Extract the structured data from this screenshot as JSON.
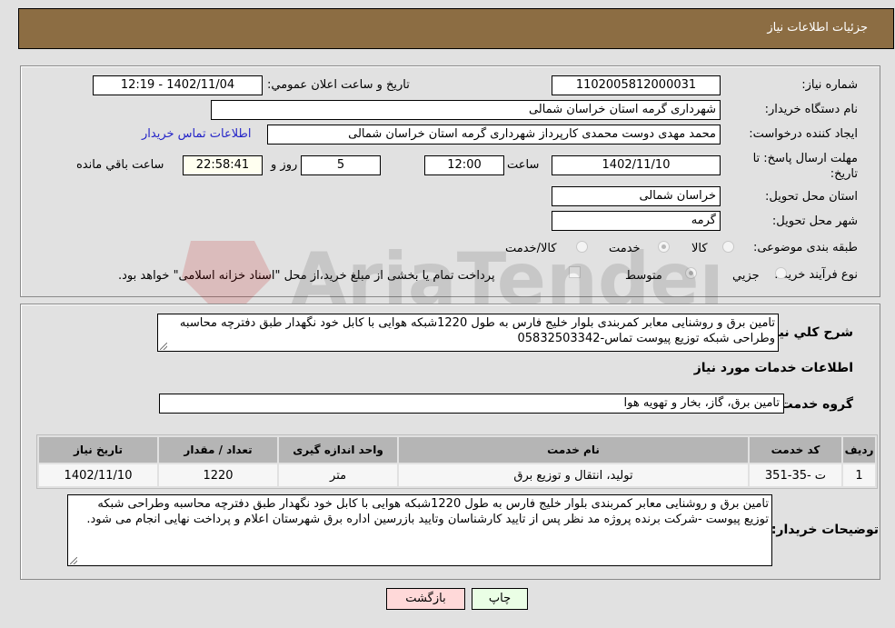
{
  "header": {
    "title": "جزئیات اطلاعات نیاز"
  },
  "details": {
    "need_number": {
      "label": "شماره نیاز:",
      "value": "1102005812000031"
    },
    "announce_datetime": {
      "label": "تاریخ و ساعت اعلان عمومي:",
      "value": "1402/11/04 - 12:19"
    },
    "buyer_org": {
      "label": "نام دستگاه خريدار:",
      "value": "شهرداری گرمه استان خراسان شمالی"
    },
    "requester": {
      "label": "ايجاد کننده درخواست:",
      "value": "محمد مهدی دوست محمدی کارپرداز شهرداری گرمه استان خراسان شمالی",
      "contact_link": "اطلاعات تماس خریدار"
    },
    "deadline": {
      "label": "مهلت ارسال پاسخ: تا تاریخ:",
      "date": "1402/11/10",
      "time_label": "ساعت",
      "time": "12:00",
      "days": "5",
      "days_label": "روز و",
      "remaining": "22:58:41",
      "remaining_label": "ساعت باقي مانده"
    },
    "delivery_province": {
      "label": "استان محل تحویل:",
      "value": "خراسان شمالی"
    },
    "delivery_city": {
      "label": "شهر محل تحویل:",
      "value": "گرمه"
    },
    "category": {
      "label": "طبقه بندی موضوعی:",
      "options": [
        "کالا",
        "خدمت",
        "کالا/خدمت"
      ],
      "selected": "خدمت"
    },
    "purchase_type": {
      "label": "نوع فرآیند خرید :",
      "options": [
        "جزيي",
        "متوسط"
      ],
      "selected": "متوسط",
      "treasury_note": "پرداخت تمام یا بخشی از مبلغ خرید،از محل \"اسناد خزانه اسلامی\" خواهد بود.",
      "treasury_checked": false
    }
  },
  "general": {
    "label": "شرح کلي نياز:",
    "text": "تامین برق و روشنایی معابر کمربندی بلوار خلیج فارس  به طول 1220شبکه هوایی با کابل خود نگهدار طبق دفترچه محاسبه وطراحی شبکه توزیع پیوست تماس-05832503342"
  },
  "services": {
    "section_title": "اطلاعات خدمات مورد نياز",
    "group_label": "گروه خدمت:",
    "group_value": "تامین برق، گاز، بخار و تهویه هوا",
    "table": {
      "headers": [
        "رديف",
        "کد خدمت",
        "نام خدمت",
        "واحد اندازه گيری",
        "تعداد / مقدار",
        "تاريخ نياز"
      ],
      "rows": [
        [
          "1",
          "ت -35-351",
          "تولید، انتقال و توزیع برق",
          "متر",
          "1220",
          "1402/11/10"
        ]
      ]
    }
  },
  "buyer_notes": {
    "label": "توضيحات خريدار:",
    "text": "تامین برق و روشنایی معابر کمربندی بلوار خلیج فارس  به طول 1220شبکه هوایی با کابل خود نگهدار طبق دفترچه محاسبه وطراحی شبکه توزیع پیوست -شرکت برنده پروژه مد نظر پس از تایید کارشناسان وتایید بازرسین اداره برق شهرستان اعلام و پرداخت نهایی انجام می شود."
  },
  "buttons": {
    "print": "چاپ",
    "back": "بازگشت"
  },
  "watermark": {
    "text": "AriaTender.net"
  }
}
